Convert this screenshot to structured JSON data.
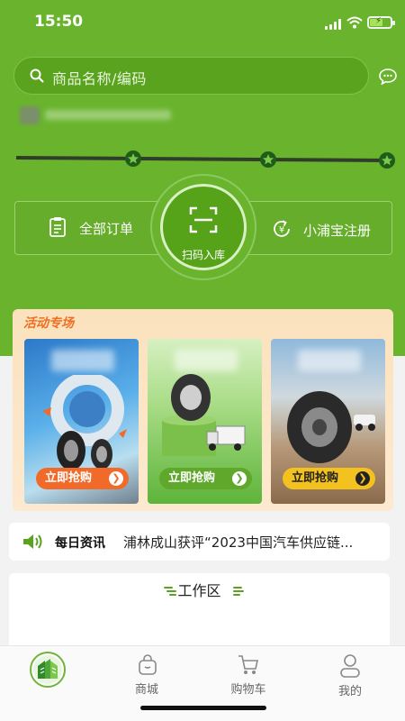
{
  "status": {
    "time": "15:50"
  },
  "search": {
    "placeholder": "商品名称/编码"
  },
  "actions": {
    "orders": "全部订单",
    "scan": "扫码入库",
    "register": "小浦宝注册"
  },
  "promo": {
    "title": "活动专场",
    "cards": [
      {
        "button": "立即抢购",
        "button_color": "#f26a2a"
      },
      {
        "button": "立即抢购",
        "button_color": "#5fa82b"
      },
      {
        "button": "立即抢购",
        "button_color": "#f4c21e"
      }
    ]
  },
  "news": {
    "label": "每日资讯",
    "text": "浦林成山获评“2023中国汽车供应链..."
  },
  "workspace": {
    "title": "工作区"
  },
  "tabbar": {
    "items": [
      "商城",
      "购物车",
      "我的"
    ]
  },
  "colors": {
    "brand": "#6ab42d",
    "accent": "#ef6f22"
  }
}
